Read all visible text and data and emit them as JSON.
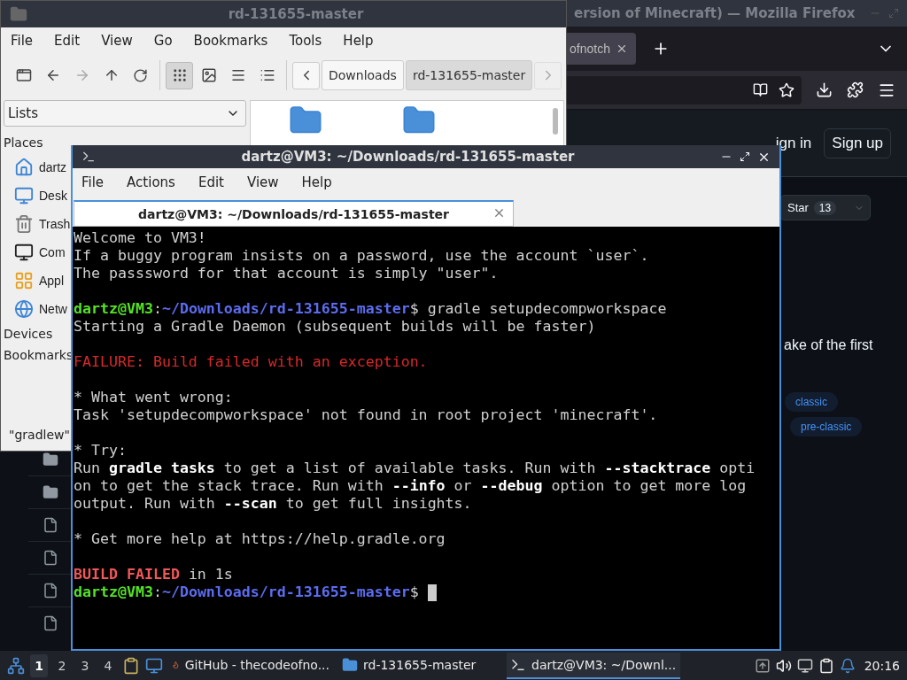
{
  "firefox": {
    "title": "ersion of Minecraft) — Mozilla Firefox",
    "tab": {
      "label": "ofnotch"
    },
    "page": {
      "sign_in": "ign in",
      "sign_up": "Sign up",
      "star": {
        "label": "Star",
        "count": "13"
      },
      "description": "ake of the first",
      "topics": [
        "classic",
        "pre-classic"
      ],
      "file_rows": [
        {
          "kind": "folder"
        },
        {
          "kind": "folder"
        },
        {
          "kind": "file"
        },
        {
          "kind": "file"
        },
        {
          "kind": "file"
        },
        {
          "kind": "file"
        }
      ]
    }
  },
  "file_manager": {
    "title": "rd-131655-master",
    "menu": [
      "File",
      "Edit",
      "View",
      "Go",
      "Bookmarks",
      "Tools",
      "Help"
    ],
    "view_buttons": [
      {
        "selected": true
      },
      {
        "selected": false
      },
      {
        "selected": false
      },
      {
        "selected": false
      }
    ],
    "breadcrumbs": [
      {
        "label": "Downloads",
        "selected": false
      },
      {
        "label": "rd-131655-master",
        "selected": true
      }
    ],
    "side_panel": {
      "mode": "Lists",
      "sections": [
        {
          "label": "Places",
          "items": [
            {
              "label": "dartz",
              "kind": "home"
            },
            {
              "label": "Desk",
              "kind": "desktop"
            },
            {
              "label": "Trash",
              "kind": "trash"
            },
            {
              "label": "Com",
              "kind": "computer"
            },
            {
              "label": "Appl",
              "kind": "apps"
            },
            {
              "label": "Netw",
              "kind": "network"
            }
          ]
        },
        {
          "label": "Devices"
        },
        {
          "label": "Bookmarks"
        }
      ]
    },
    "status": "\"gradlew\""
  },
  "terminal": {
    "title": "dartz@VM3: ~/Downloads/rd-131655-master",
    "menu": [
      "File",
      "Actions",
      "Edit",
      "View",
      "Help"
    ],
    "tab": {
      "label": "dartz@VM3: ~/Downloads/rd-131655-master",
      "selected": true
    },
    "lines": [
      {
        "segments": [
          {
            "kind": "text",
            "text": "Welcome to VM3!"
          }
        ]
      },
      {
        "segments": [
          {
            "kind": "text",
            "text": "If a buggy program insists on a password, use the account `user`."
          }
        ]
      },
      {
        "segments": [
          {
            "kind": "text",
            "text": "The passsword for that account is simply \"user\"."
          }
        ]
      },
      {
        "gap_before": true,
        "segments": [
          {
            "kind": "user",
            "text": "dartz@VM3"
          },
          {
            "kind": "text",
            "text": ":"
          },
          {
            "kind": "path",
            "text": "~/Downloads/rd-131655-master"
          },
          {
            "kind": "text",
            "text": "$ gradle setupdecompworkspace"
          }
        ]
      },
      {
        "segments": [
          {
            "kind": "text",
            "text": "Starting a Gradle Daemon (subsequent builds will be faster)"
          }
        ]
      },
      {
        "gap_before": true,
        "segments": [
          {
            "kind": "error",
            "text": "FAILURE: Build failed with an exception."
          }
        ]
      },
      {
        "gap_before": true,
        "segments": [
          {
            "kind": "text",
            "text": "* What went wrong:"
          }
        ]
      },
      {
        "segments": [
          {
            "kind": "text",
            "text": "Task 'setupdecompworkspace' not found in root project 'minecraft'."
          }
        ]
      },
      {
        "gap_before": true,
        "segments": [
          {
            "kind": "text",
            "text": "* Try:"
          }
        ]
      },
      {
        "segments": [
          {
            "kind": "text",
            "text": "Run "
          },
          {
            "kind": "bold",
            "text": "gradle tasks"
          },
          {
            "kind": "text",
            "text": " to get a list of available tasks. Run with "
          },
          {
            "kind": "bold",
            "text": "--stacktrace"
          },
          {
            "kind": "text",
            "text": " opti"
          }
        ]
      },
      {
        "segments": [
          {
            "kind": "text",
            "text": "on to get the stack trace. Run with "
          },
          {
            "kind": "bold",
            "text": "--info"
          },
          {
            "kind": "text",
            "text": " or "
          },
          {
            "kind": "bold",
            "text": "--debug"
          },
          {
            "kind": "text",
            "text": " option to get more log"
          }
        ]
      },
      {
        "segments": [
          {
            "kind": "text",
            "text": "output. Run with "
          },
          {
            "kind": "bold",
            "text": "--scan"
          },
          {
            "kind": "text",
            "text": " to get full insights."
          }
        ]
      },
      {
        "gap_before": true,
        "segments": [
          {
            "kind": "text",
            "text": "* Get more help at https://help.gradle.org"
          }
        ]
      },
      {
        "gap_before": true,
        "segments": [
          {
            "kind": "error-bold",
            "text": "BUILD FAILED"
          },
          {
            "kind": "text",
            "text": " in 1s"
          }
        ]
      },
      {
        "cursor": true,
        "segments": [
          {
            "kind": "user",
            "text": "dartz@VM3"
          },
          {
            "kind": "text",
            "text": ":"
          },
          {
            "kind": "path",
            "text": "~/Downloads/rd-131655-master"
          },
          {
            "kind": "text",
            "text": "$ "
          }
        ]
      }
    ]
  },
  "taskbar": {
    "workspaces": [
      {
        "label": "1",
        "selected": true
      },
      {
        "label": "2",
        "selected": false
      },
      {
        "label": "3",
        "selected": false
      },
      {
        "label": "4",
        "selected": false
      }
    ],
    "tasks": [
      {
        "kind": "browser",
        "label": "GitHub - thecodeofno...",
        "selected": false
      },
      {
        "kind": "files",
        "label": "rd-131655-master",
        "selected": false
      },
      {
        "kind": "terminal",
        "label": "dartz@VM3: ~/Downl...",
        "selected": true
      }
    ],
    "clock": "20:16"
  }
}
